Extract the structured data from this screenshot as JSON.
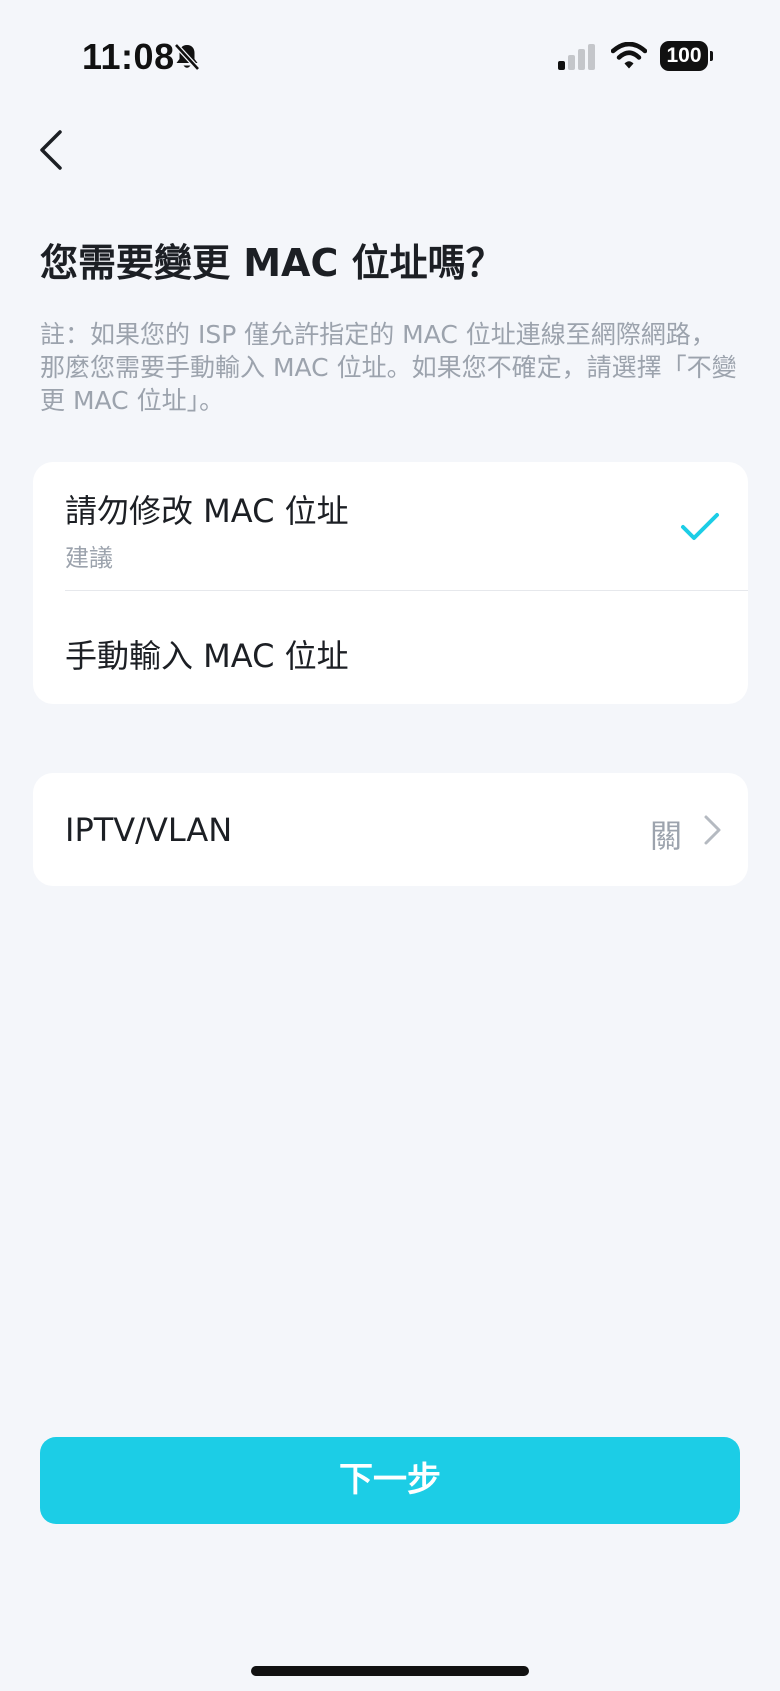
{
  "status_bar": {
    "time": "11:08",
    "battery": "100",
    "icons": [
      "bell-muted-icon",
      "cellular-signal-icon",
      "wifi-icon",
      "battery-icon"
    ]
  },
  "nav": {
    "back_icon": "chevron-left-icon"
  },
  "title": "您需要變更 MAC 位址嗎？",
  "note": "註：如果您的 ISP 僅允許指定的 MAC 位址連線至網際網路，那麼您需要手動輸入 MAC 位址。如果您不確定，請選擇「不變更 MAC 位址」。",
  "mac_options": [
    {
      "label": "請勿修改 MAC 位址",
      "sub": "建議",
      "selected": true
    },
    {
      "label": "手動輸入 MAC 位址",
      "selected": false
    }
  ],
  "iptv": {
    "label": "IPTV/VLAN",
    "value": "關"
  },
  "next_button": "下一步",
  "colors": {
    "accent": "#1ccde6",
    "check": "#1ccde6",
    "background": "#f4f6fa",
    "card": "#ffffff"
  }
}
